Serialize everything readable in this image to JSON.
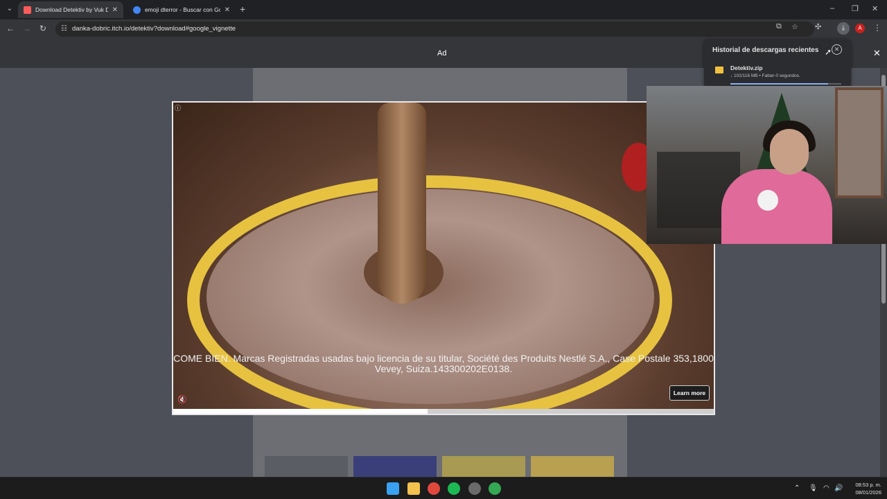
{
  "browser": {
    "tabs": [
      {
        "title": "Download Detektiv by Vuk Dob",
        "active": true,
        "favicon_color": "#fa5c5c"
      },
      {
        "title": "emoji dterror - Buscar con Goo",
        "active": false,
        "favicon_color": "#4285f4"
      }
    ],
    "address": "danka-dobric.itch.io/detektiv?download#google_vignette",
    "profile_initial": "A"
  },
  "ad": {
    "label": "Ad",
    "caption": "COME BIEN. Marcas Registradas usadas bajo licencia de su titular, Société des Produits Nestlé S.A., Case Postale 353,1800 Vevey, Suiza.143300202E0138.",
    "learn_more": "Learn more",
    "progress": 0.47
  },
  "downloads": {
    "title": "Historial de descargas recientes",
    "file_name": "Detektiv.zip",
    "status": "↓ 102/116 MB • Faltan 0 segundos.",
    "progress": 0.88
  },
  "taskbar": {
    "time": "08:53 p. m.",
    "date": "08/01/2026"
  },
  "colors": {
    "accent": "#8ab4f8",
    "pot": "#e6c240"
  }
}
